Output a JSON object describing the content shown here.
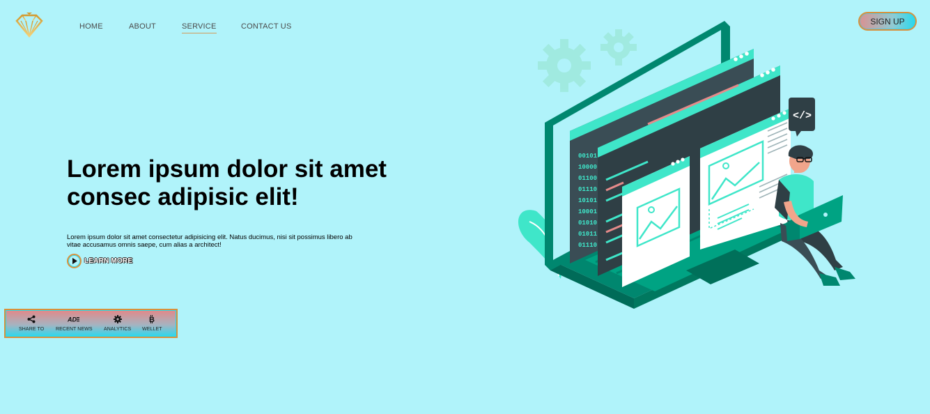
{
  "header": {
    "logo_icon": "diamond-logo",
    "nav": [
      {
        "label": "HOME",
        "active": false
      },
      {
        "label": "ABOUT",
        "active": false
      },
      {
        "label": "SERVICE",
        "active": true
      },
      {
        "label": "CONTACT US",
        "active": false
      }
    ],
    "signup_label": "SIGN UP"
  },
  "hero": {
    "title": "Lorem ipsum dolor sit amet consec adipisic elit!",
    "description": "Lorem ipsum dolor sit amet consectetur adipisicing elit. Natus ducimus, nisi sit possimus libero ab vitae accusamus omnis saepe, cum alias a architect!",
    "learn_more_label": "LEARN MORE",
    "play_icon": "play-icon"
  },
  "dock": {
    "items": [
      {
        "icon": "share-icon",
        "label": "SHARE TO"
      },
      {
        "icon": "ad-icon",
        "label": "RECENT NEWS"
      },
      {
        "icon": "gear-icon",
        "label": "ANALYTICS"
      },
      {
        "icon": "bitcoin-icon",
        "label": "WELLET"
      }
    ]
  },
  "illustration": {
    "code_tag": "</>"
  },
  "colors": {
    "background": "#b0f3fa",
    "accent_orange": "#d9913c",
    "accent_cyan": "#27d9ee",
    "teal_dark": "#00876f",
    "teal_light": "#3fe6c9"
  }
}
